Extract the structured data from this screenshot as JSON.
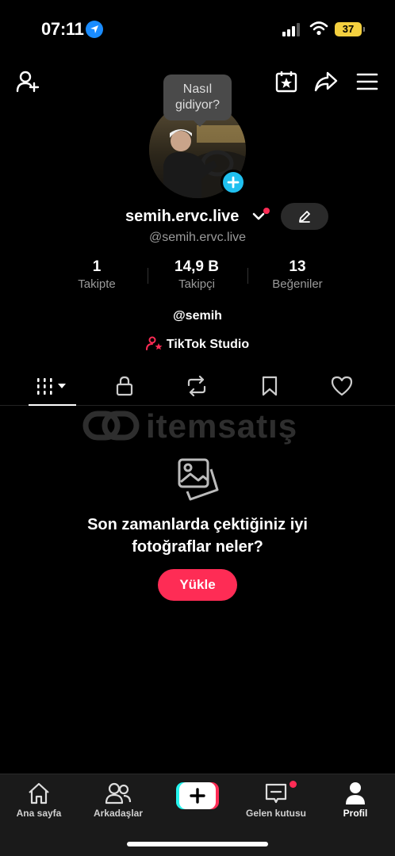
{
  "status_bar": {
    "time": "07:11",
    "battery": "37"
  },
  "header": {
    "tooltip": "Nasıl gidiyor?"
  },
  "profile": {
    "display_name": "semih.ervc.live",
    "handle": "@semih.ervc.live",
    "stats": [
      {
        "value": "1",
        "label": "Takipte"
      },
      {
        "value": "14,9 B",
        "label": "Takipçi"
      },
      {
        "value": "13",
        "label": "Beğeniler"
      }
    ],
    "bio": "@semih",
    "studio_label": "TikTok Studio"
  },
  "watermark": {
    "text": "itemsatış"
  },
  "empty_state": {
    "message": "Son zamanlarda çektiğiniz iyi fotoğraflar neler?",
    "upload_label": "Yükle"
  },
  "bottom_nav": {
    "items": [
      {
        "label": "Ana sayfa",
        "icon": "home-icon"
      },
      {
        "label": "Arkadaşlar",
        "icon": "friends-icon"
      },
      {
        "label": "Gelen kutusu",
        "icon": "inbox-icon"
      },
      {
        "label": "Profil",
        "icon": "profile-icon"
      }
    ]
  },
  "colors": {
    "accent": "#fe2c55",
    "cyan": "#25f4ee",
    "avatar_add": "#20c0f0",
    "battery": "#f4d03f"
  }
}
